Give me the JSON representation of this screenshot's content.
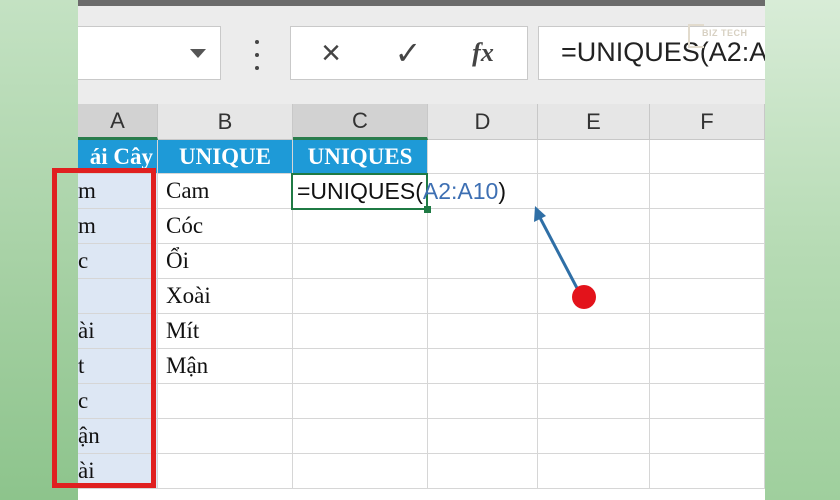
{
  "formula_bar": {
    "cancel_icon": "×",
    "enter_icon": "✓",
    "fx_icon": "fx",
    "formula_text": "=UNIQUES(A2:A",
    "watermark": "BIZ TECH"
  },
  "columns": [
    "A",
    "B",
    "C",
    "D",
    "E",
    "F"
  ],
  "header_row": {
    "a": "ái Cây",
    "b": "UNIQUE",
    "c": "UNIQUES"
  },
  "column_a": [
    "m",
    "m",
    "c",
    "",
    "ài",
    "t",
    "c",
    "ận",
    "ài"
  ],
  "column_b": [
    "Cam",
    "Cóc",
    "Ổi",
    "Xoài",
    "Mít",
    "Mận"
  ],
  "active_cell": {
    "formula_prefix": "=UNIQUES(",
    "formula_ref": "A2:A10",
    "formula_suffix": ")"
  },
  "colors": {
    "header_fill": "#1e9ad7",
    "annotation_red": "#e02020",
    "arrow_blue": "#2f6fa6",
    "active_border": "#1f7a44"
  }
}
